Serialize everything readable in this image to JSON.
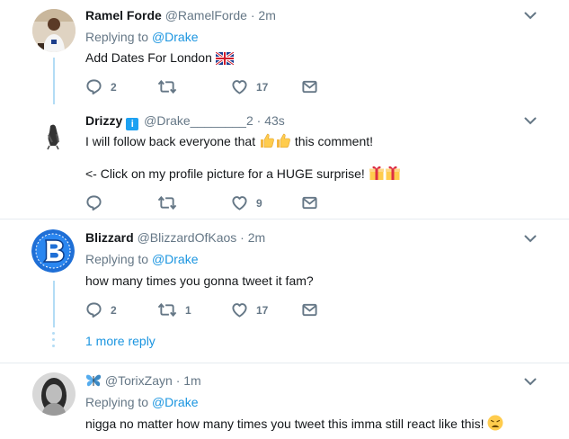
{
  "tweets": [
    {
      "name": "Ramel Forde",
      "handle": "@RamelForde",
      "sep": "·",
      "time": "2m",
      "replying_prefix": "Replying to",
      "replying_to": "@Drake",
      "text": "Add Dates For London",
      "reply_count": "2",
      "retweet_count": "",
      "like_count": "17"
    },
    {
      "name": "Drizzy",
      "verified_mark": "i",
      "handle": "@Drake________2",
      "sep": "·",
      "time": "43s",
      "line1_before": "I will follow back everyone that",
      "line1_after": "this comment!",
      "line2": "<- Click on my profile picture for a HUGE surprise!",
      "reply_count": "",
      "retweet_count": "",
      "like_count": "9"
    },
    {
      "name": "Blizzard",
      "handle": "@BlizzardOfKaos",
      "sep": "·",
      "time": "2m",
      "replying_prefix": "Replying to",
      "replying_to": "@Drake",
      "text": "how many times you gonna tweet it fam?",
      "reply_count": "2",
      "retweet_count": "1",
      "like_count": "17",
      "more_replies": "1 more reply"
    },
    {
      "name": "",
      "handle": "@TorixZayn",
      "sep": "·",
      "time": "1m",
      "replying_prefix": "Replying to",
      "replying_to": "@Drake",
      "text": "nigga no matter how many times you tweet this imma still react like this!",
      "reply_count": "",
      "retweet_count": "",
      "like_count": ""
    }
  ],
  "colors": {
    "link": "#1b95e0",
    "muted": "#657786",
    "text": "#14171a",
    "thread": "#b3dcf5",
    "divider": "#e6ecf0",
    "verified": "#1da1f2"
  },
  "icons": [
    "chevron-down-icon",
    "reply-icon",
    "retweet-icon",
    "heart-icon",
    "message-icon",
    "uk-flag-emoji",
    "thumbs-up-emoji",
    "gift-emoji",
    "butterfly-emoji",
    "weary-face-emoji"
  ]
}
